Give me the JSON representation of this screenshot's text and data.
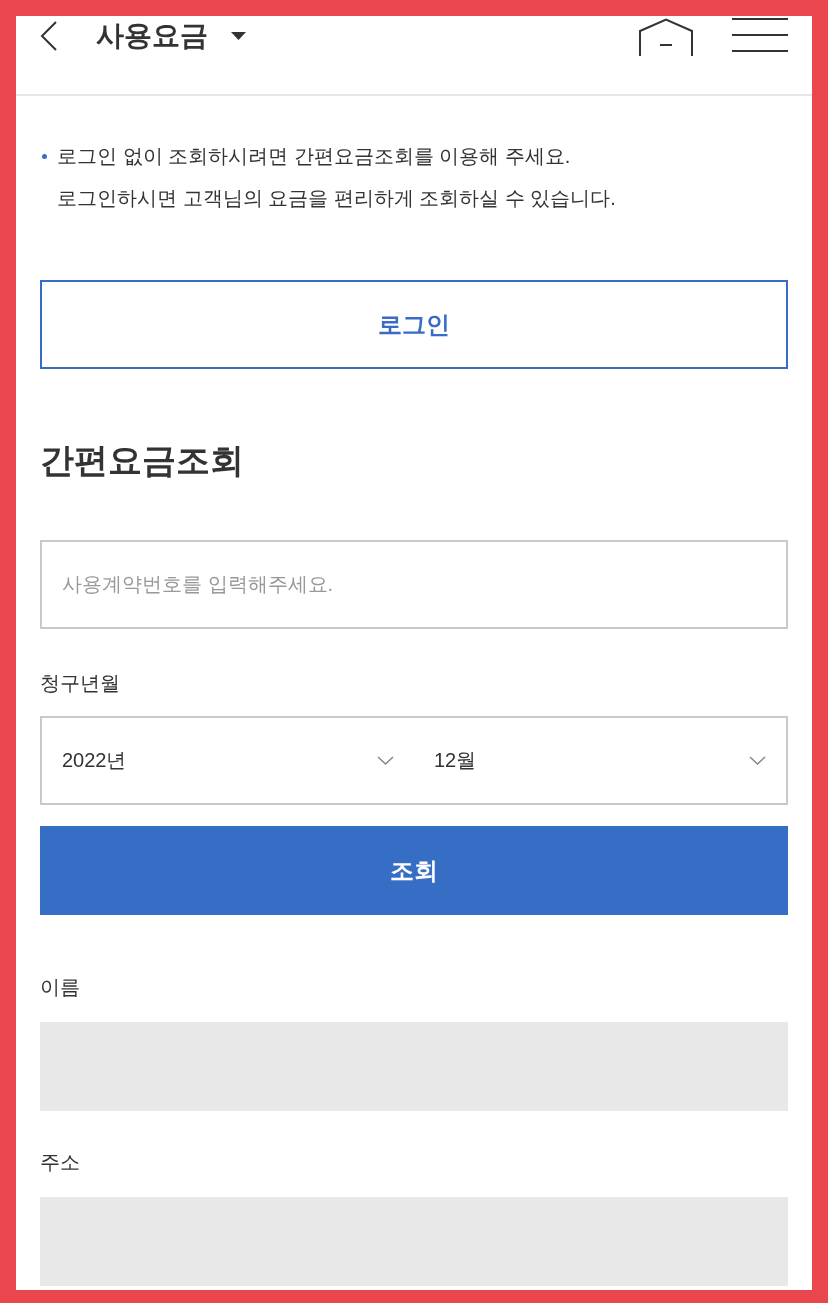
{
  "header": {
    "title": "사용요금"
  },
  "notice": {
    "text": "로그인 없이 조회하시려면 간편요금조회를 이용해 주세요.\n로그인하시면 고객님의 요금을 편리하게 조회하실 수 있습니다."
  },
  "login_button": {
    "label": "로그인"
  },
  "quick_lookup": {
    "title": "간편요금조회",
    "contract_number": {
      "placeholder": "사용계약번호를 입력해주세요."
    },
    "billing_month": {
      "label": "청구년월",
      "selects": [
        {
          "value": "2022년"
        },
        {
          "value": "12월"
        }
      ]
    },
    "search_button": {
      "label": "조회"
    },
    "fields": [
      {
        "label": "이름",
        "disabled": true
      },
      {
        "label": "주소",
        "disabled": true
      }
    ]
  }
}
